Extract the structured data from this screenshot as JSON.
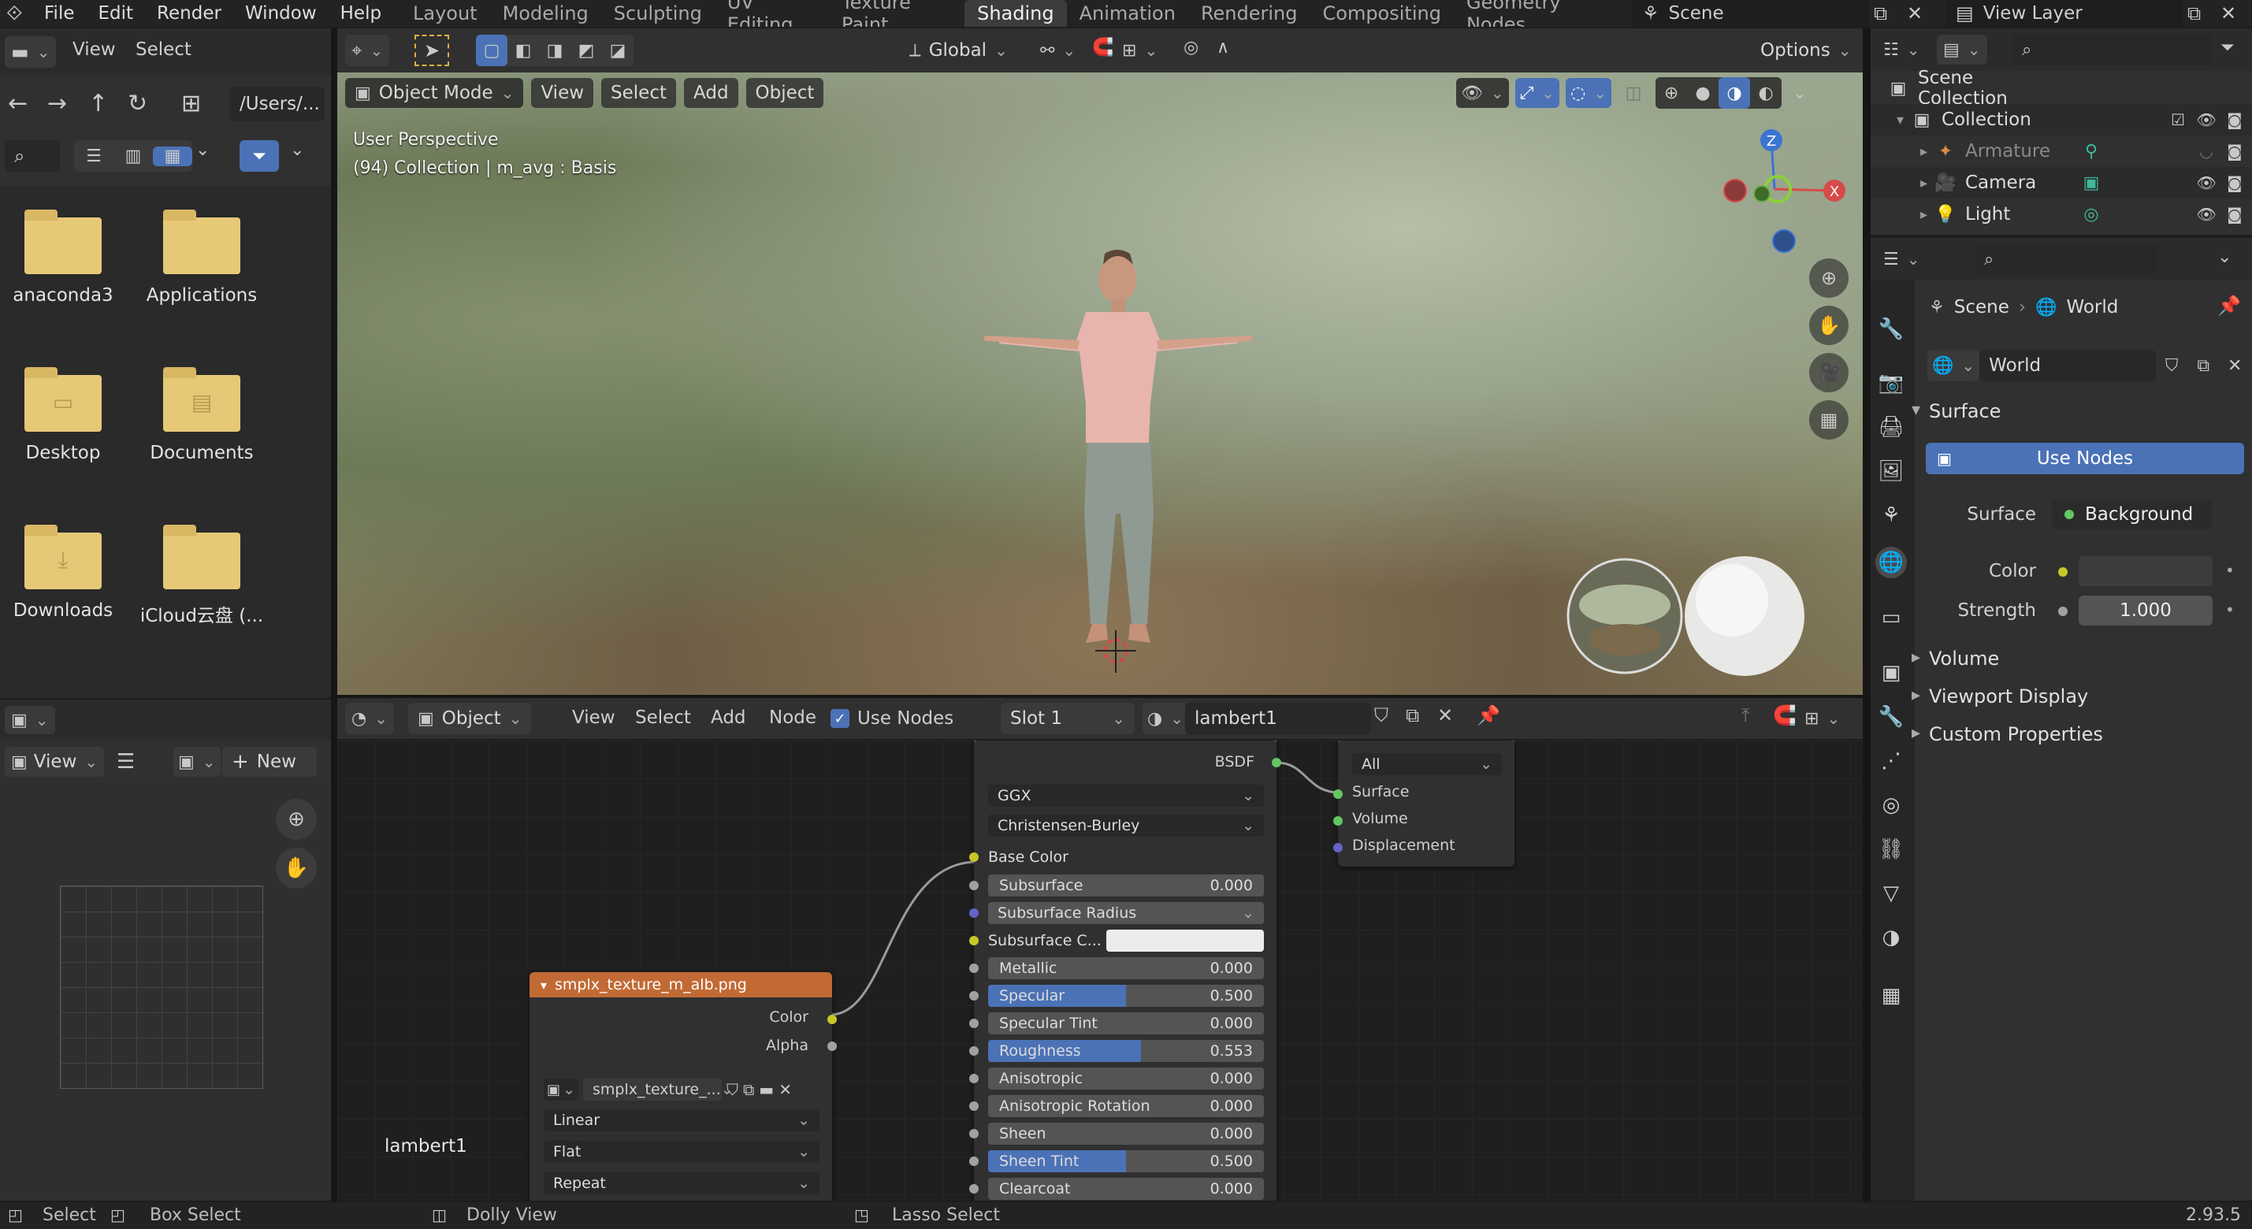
{
  "menu": {
    "file": "File",
    "edit": "Edit",
    "render": "Render",
    "window": "Window",
    "help": "Help"
  },
  "workspaces": [
    "Layout",
    "Modeling",
    "Sculpting",
    "UV Editing",
    "Texture Paint",
    "Shading",
    "Animation",
    "Rendering",
    "Compositing",
    "Geometry Nodes"
  ],
  "active_workspace": "Shading",
  "scene_name": "Scene",
  "view_layer": "View Layer",
  "file_browser": {
    "path": "/Users/...",
    "items": [
      "anaconda3",
      "Applications",
      "Desktop",
      "Documents",
      "Downloads",
      "iCloud云盘 (..."
    ]
  },
  "image_editor": {
    "view": "View",
    "new": "New"
  },
  "viewport_header": {
    "transform": "Global",
    "options": "Options",
    "mode": "Object Mode",
    "view": "View",
    "select": "Select",
    "add": "Add",
    "object": "Object"
  },
  "viewport": {
    "perspective": "User Perspective",
    "info": "(94) Collection | m_avg : Basis"
  },
  "node_header": {
    "object": "Object",
    "view": "View",
    "select": "Select",
    "add": "Add",
    "node": "Node",
    "use_nodes": "Use Nodes",
    "slot": "Slot 1",
    "material": "lambert1"
  },
  "bsdf": {
    "output": "BSDF",
    "distribution": "GGX",
    "subsurface_method": "Christensen-Burley",
    "base_color": "Base Color",
    "fields": [
      {
        "label": "Subsurface",
        "value": "0.000",
        "fill": 0
      },
      {
        "label": "Subsurface Radius",
        "value": "",
        "fill": 0,
        "dropdown": true
      },
      {
        "label": "Subsurface C...",
        "value": "",
        "fill": 0,
        "color": true
      },
      {
        "label": "Metallic",
        "value": "0.000",
        "fill": 0
      },
      {
        "label": "Specular",
        "value": "0.500",
        "fill": 0.5
      },
      {
        "label": "Specular Tint",
        "value": "0.000",
        "fill": 0
      },
      {
        "label": "Roughness",
        "value": "0.553",
        "fill": 0.553
      },
      {
        "label": "Anisotropic",
        "value": "0.000",
        "fill": 0
      },
      {
        "label": "Anisotropic Rotation",
        "value": "0.000",
        "fill": 0
      },
      {
        "label": "Sheen",
        "value": "0.000",
        "fill": 0
      },
      {
        "label": "Sheen Tint",
        "value": "0.500",
        "fill": 0.5
      },
      {
        "label": "Clearcoat",
        "value": "0.000",
        "fill": 0
      }
    ]
  },
  "output_node": {
    "target": "All",
    "inputs": [
      "Surface",
      "Volume",
      "Displacement"
    ]
  },
  "image_node": {
    "title": "smplx_texture_m_alb.png",
    "out_color": "Color",
    "out_alpha": "Alpha",
    "image": "smplx_texture_...",
    "interpolation": "Linear",
    "projection": "Flat",
    "extension": "Repeat"
  },
  "node_tree_label": "lambert1",
  "outliner": {
    "scene_collection": "Scene Collection",
    "collection": "Collection",
    "objects": [
      "Armature",
      "Camera",
      "Light"
    ]
  },
  "properties": {
    "tab_scene": "Scene",
    "tab_world": "World",
    "world_name": "World",
    "surface_section": "Surface",
    "use_nodes": "Use Nodes",
    "surface_label": "Surface",
    "surface_value": "Background",
    "color_label": "Color",
    "strength_label": "Strength",
    "strength_value": "1.000",
    "sections": [
      "Volume",
      "Viewport Display",
      "Custom Properties"
    ]
  },
  "status": {
    "select": "Select",
    "box_select": "Box Select",
    "dolly": "Dolly View",
    "lasso": "Lasso Select",
    "version": "2.93.5"
  }
}
